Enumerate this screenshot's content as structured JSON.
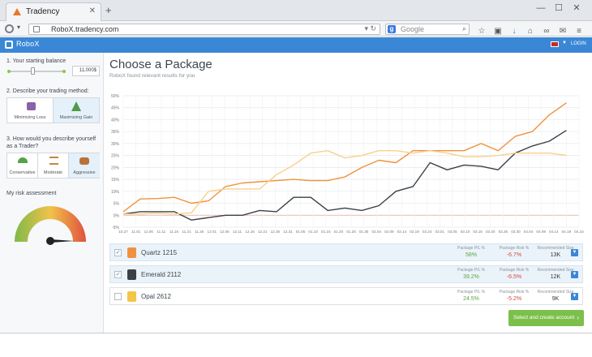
{
  "browser": {
    "tab_title": "Tradency",
    "url": "RoboX.tradency.com",
    "search_placeholder": "Google"
  },
  "app": {
    "logo": "RoboX",
    "login": "LOGIN",
    "colors": {
      "header": "#3a87d6",
      "accent_orange": "#f0923d",
      "accent_green": "#7cc04b"
    }
  },
  "sidebar": {
    "balance_label": "1. Your starting balance",
    "balance_value": "11,000$",
    "method_label": "2. Describe your trading method:",
    "methods": [
      {
        "label": "Minimizing Loss",
        "icon": "bag-icon"
      },
      {
        "label": "Maximizing Gain",
        "icon": "tree-icon"
      }
    ],
    "trader_label": "3. How would you describe yourself as a Trader?",
    "traders": [
      {
        "label": "Conservative",
        "icon": "umbrella-icon"
      },
      {
        "label": "Moderate",
        "icon": "scale-icon"
      },
      {
        "label": "Aggressive",
        "icon": "bull-icon"
      }
    ],
    "risk_label": "My risk assessment"
  },
  "main": {
    "title": "Choose a Package",
    "subtitle": "RoboX found relevant results for you"
  },
  "chart_data": {
    "type": "line",
    "ylim": [
      -5,
      50
    ],
    "yticks": [
      "50%",
      "45%",
      "40%",
      "35%",
      "30%",
      "25%",
      "20%",
      "15%",
      "10%",
      "5%",
      "0%",
      "-5%"
    ],
    "x": [
      "10.27",
      "11.01",
      "11.06",
      "11.11",
      "11.16",
      "11.21",
      "11.26",
      "12.01",
      "12.06",
      "12.11",
      "12.16",
      "12.21",
      "12.26",
      "12.31",
      "01.05",
      "01.10",
      "01.15",
      "01.20",
      "01.25",
      "01.30",
      "02.04",
      "02.09",
      "02.14",
      "02.19",
      "02.24",
      "03.01",
      "03.05",
      "03.10",
      "03.15",
      "03.20",
      "03.25",
      "03.30",
      "04.04",
      "04.09",
      "04.14",
      "04.19",
      "04.24"
    ],
    "series": [
      {
        "name": "",
        "color": "#f0923d",
        "values": [
          1.5,
          6.8,
          7,
          7.5,
          5,
          6,
          12,
          13.5,
          14,
          14.5,
          15,
          14.5,
          14.5,
          16,
          20,
          23,
          22,
          27,
          27,
          27,
          27,
          30,
          27,
          33,
          35,
          42,
          47
        ]
      },
      {
        "name": "",
        "color": "#3b4047",
        "values": [
          0.5,
          1.5,
          1.5,
          1.5,
          -2,
          -1,
          0,
          0,
          2,
          1.5,
          7.5,
          7.5,
          2,
          3,
          2,
          4,
          10,
          12,
          22,
          19,
          21,
          20.5,
          19,
          26,
          29,
          31,
          35.5
        ]
      },
      {
        "name": "",
        "color": "#f8d08a",
        "values": [
          0.5,
          0.5,
          0.8,
          0.5,
          1,
          10,
          11,
          11,
          11,
          17,
          21,
          26,
          27,
          24,
          25,
          27,
          27,
          26,
          27,
          26,
          24.5,
          24.5,
          25,
          26,
          26,
          26,
          25
        ]
      }
    ]
  },
  "packages": [
    {
      "name": "Quartz 1215",
      "checked": "✓",
      "pl": "58%",
      "risk": "-6.7%",
      "size": "13K",
      "color": "#f0923d"
    },
    {
      "name": "Emerald 2112",
      "checked": "✓",
      "pl": "39.2%",
      "risk": "-6.5%",
      "size": "12K",
      "color": "#3b4047"
    },
    {
      "name": "Opal 2612",
      "checked": "",
      "pl": "24.5%",
      "risk": "-5.2%",
      "size": "9K",
      "color": "#f5c44a"
    }
  ],
  "package_headers": {
    "pl": "Package P/L %",
    "risk": "Package Risk %",
    "size": "Recommended Size"
  },
  "cta_label": "Select and create account"
}
